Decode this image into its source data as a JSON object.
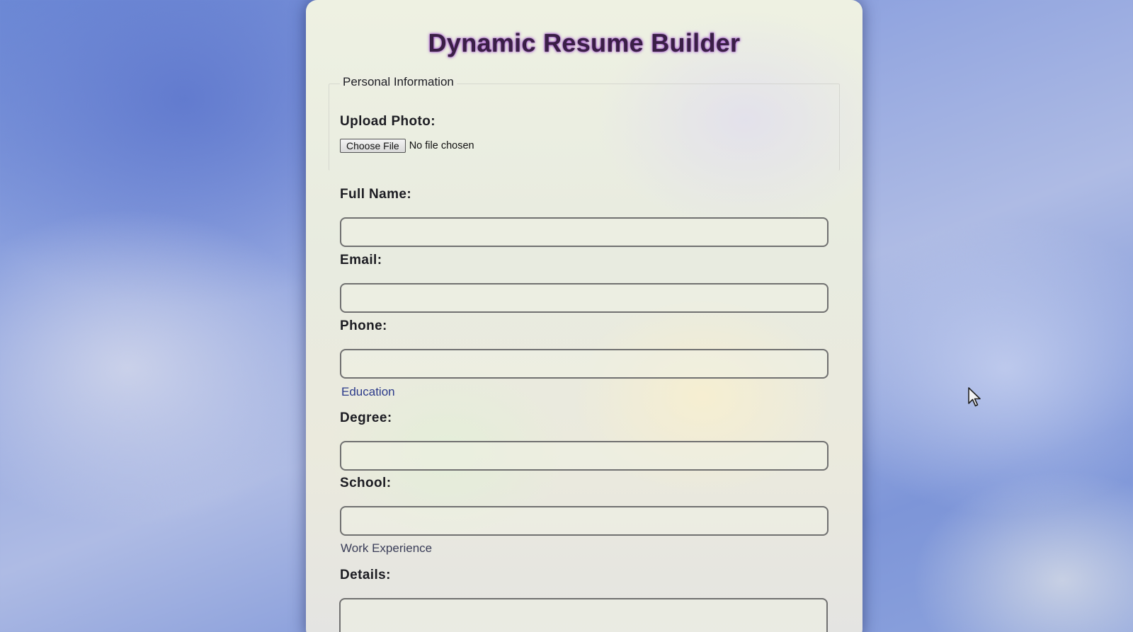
{
  "title": "Dynamic Resume Builder",
  "personal": {
    "legend": "Personal Information",
    "photo_label": "Upload Photo:",
    "choose_file_label": "Choose File",
    "file_status": "No file chosen",
    "full_name_label": "Full Name:",
    "full_name_value": "",
    "email_label": "Email:",
    "email_value": "",
    "phone_label": "Phone:",
    "phone_value": ""
  },
  "education": {
    "legend": "Education",
    "degree_label": "Degree:",
    "degree_value": "",
    "school_label": "School:",
    "school_value": ""
  },
  "work": {
    "legend": "Work Experience",
    "details_label": "Details:",
    "details_value": ""
  },
  "icons": {
    "cursor": "mouse-pointer-icon"
  },
  "colors": {
    "title_text": "#3a1f46",
    "title_glow": "#a046d2",
    "education_legend": "#2b3a8a"
  }
}
